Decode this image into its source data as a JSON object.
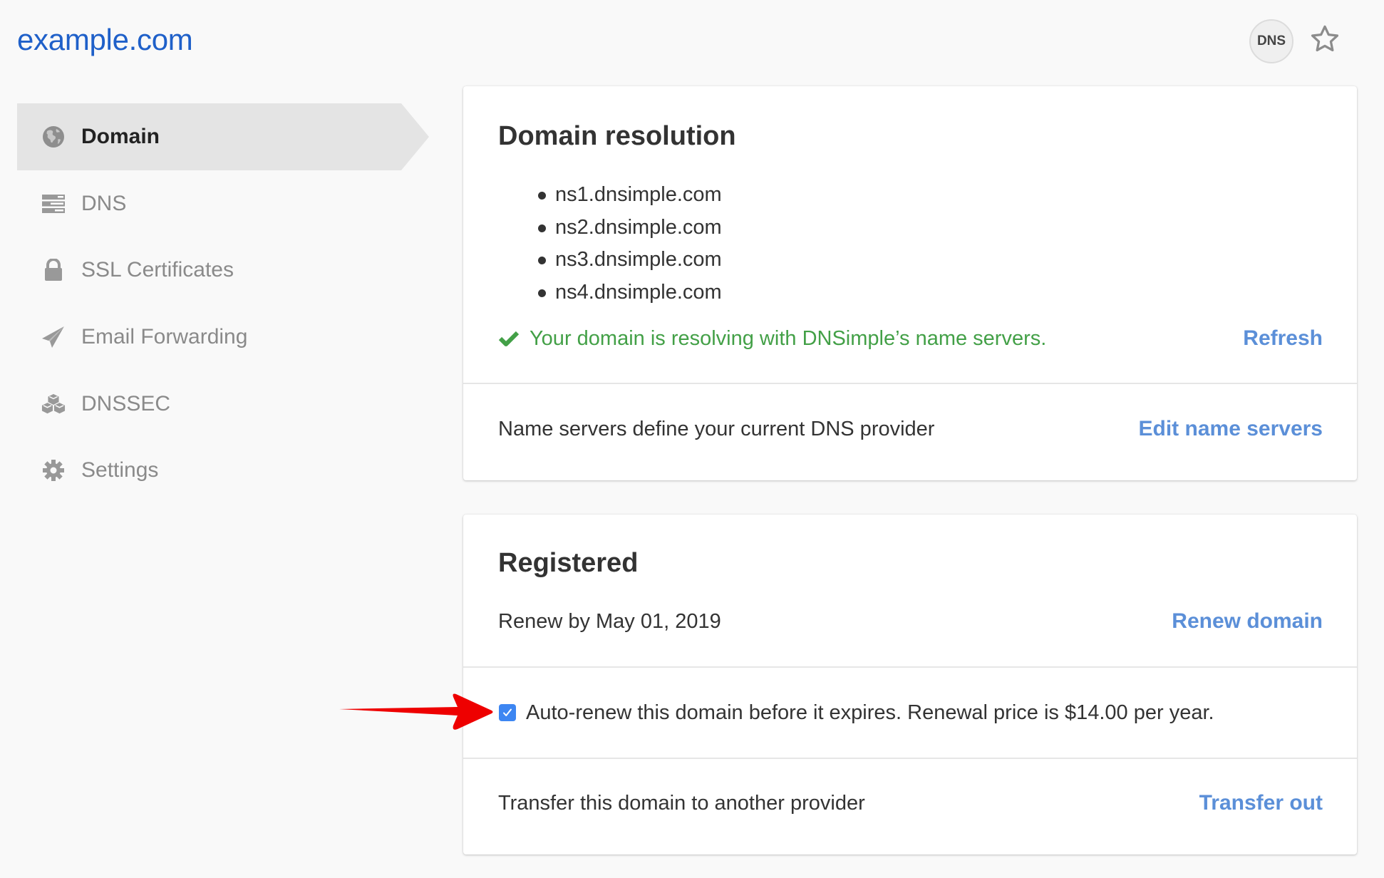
{
  "header": {
    "site_title": "example.com",
    "dns_badge": "DNS",
    "star_icon": "star-outline-icon"
  },
  "sidebar": {
    "items": [
      {
        "label": "Domain",
        "icon": "globe-icon",
        "active": true
      },
      {
        "label": "DNS",
        "icon": "server-icon",
        "active": false
      },
      {
        "label": "SSL Certificates",
        "icon": "lock-icon",
        "active": false
      },
      {
        "label": "Email Forwarding",
        "icon": "paper-plane-icon",
        "active": false
      },
      {
        "label": "DNSSEC",
        "icon": "cubes-icon",
        "active": false
      },
      {
        "label": "Settings",
        "icon": "gear-icon",
        "active": false
      }
    ]
  },
  "domain_resolution": {
    "title": "Domain resolution",
    "name_servers": [
      "ns1.dnsimple.com",
      "ns2.dnsimple.com",
      "ns3.dnsimple.com",
      "ns4.dnsimple.com"
    ],
    "status_text": "Your domain is resolving with DNSimple’s name servers.",
    "refresh_label": "Refresh",
    "name_servers_description": "Name servers define your current DNS provider",
    "edit_name_servers_label": "Edit name servers"
  },
  "registered": {
    "title": "Registered",
    "renew_by_text": "Renew by May 01, 2019",
    "renew_domain_label": "Renew domain",
    "auto_renew": {
      "checked": true,
      "label": "Auto-renew this domain before it expires. Renewal price is $14.00 per year."
    },
    "transfer_text": "Transfer this domain to another provider",
    "transfer_out_label": "Transfer out"
  },
  "colors": {
    "title_blue": "#1f60c9",
    "link_blue": "#5b8fd8",
    "success_green": "#43a047",
    "checkbox_blue": "#3d86f2",
    "annotation_red": "#ee0000"
  }
}
